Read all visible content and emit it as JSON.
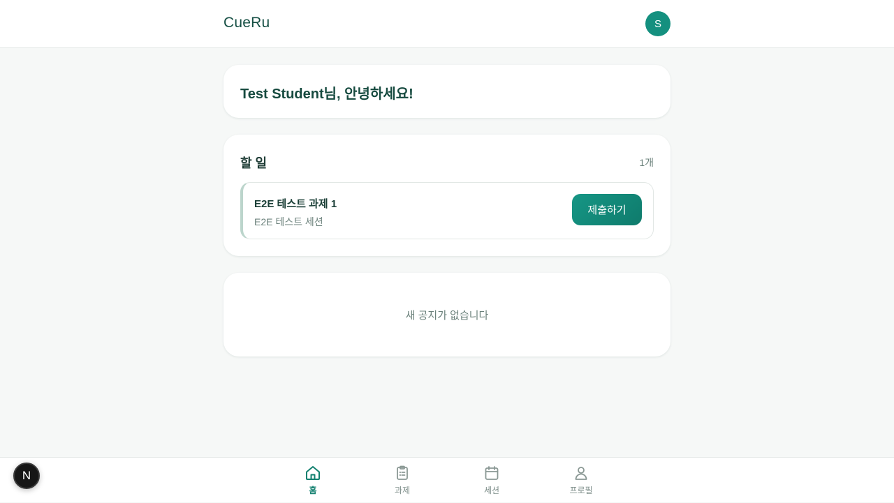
{
  "header": {
    "brand": "CueRu",
    "avatar_initial": "S"
  },
  "greeting": {
    "text": "Test Student님, 안녕하세요!"
  },
  "todo": {
    "title": "할 일",
    "count": "1개",
    "items": [
      {
        "name": "E2E 테스트 과제 1",
        "session": "E2E 테스트 세션",
        "action_label": "제출하기"
      }
    ]
  },
  "notices": {
    "empty_text": "새 공지가 없습니다"
  },
  "bottom_nav": {
    "items": [
      {
        "label": "홈",
        "icon": "home-icon",
        "active": true
      },
      {
        "label": "과제",
        "icon": "clipboard-icon",
        "active": false
      },
      {
        "label": "세션",
        "icon": "calendar-icon",
        "active": false
      },
      {
        "label": "프로필",
        "icon": "user-icon",
        "active": false
      }
    ]
  },
  "dev_badge": {
    "letter": "N"
  },
  "colors": {
    "accent": "#14907f",
    "accent_dark": "#0f7b6c",
    "background": "#f6f8f7",
    "text_primary": "#164a3f",
    "text_muted": "#6b817b"
  }
}
